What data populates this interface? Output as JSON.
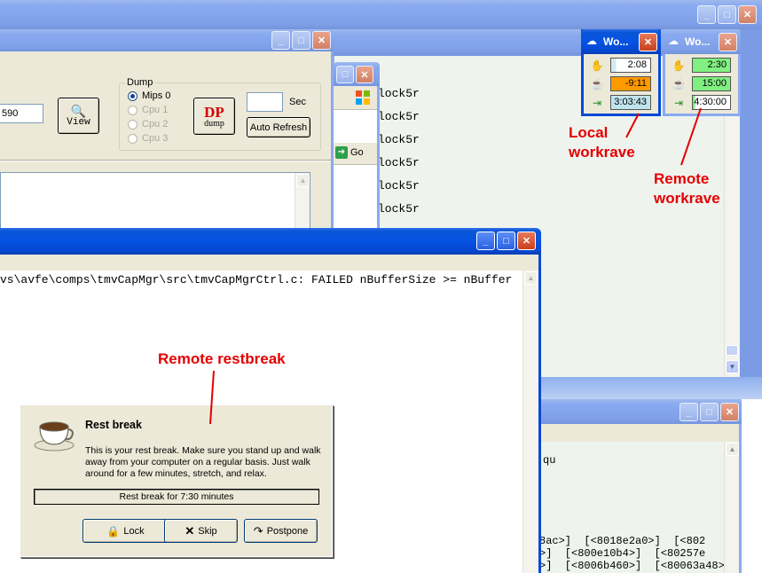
{
  "desktop": {
    "back_window": {
      "dump_group_label": "Dump",
      "radios": [
        "Mips 0",
        "Cpu 1",
        "Cpu 2",
        "Cpu 3"
      ],
      "selected_radio": "Mips 0",
      "field_value": "590",
      "view_label": "View",
      "dp_label": "DP",
      "dump_label": "dump",
      "sec_label": "Sec",
      "sec_value": "",
      "auto_refresh_label": "Auto Refresh"
    },
    "middle_window": {
      "go_label": "Go",
      "log_lines": [
        "lock5r",
        "lock5r",
        "lock5r",
        "lock5r",
        "lock5r",
        "lock5r"
      ]
    },
    "console_window": {
      "log_text": "vs\\avfe\\comps\\tmvCapMgr\\src\\tmvCapMgrCtrl.c: FAILED nBufferSize >= nBuffer"
    },
    "trace_window": {
      "top_text": "qu",
      "trace_lines": [
        "8ac>]  [<8018e2a0>]  [<802",
        ">]  [<800e10b4>]  [<80257e",
        ">]  [<8006b460>]  [<80063a48>"
      ]
    }
  },
  "workrave_local": {
    "title": "Wo...",
    "micro_value": "2:08",
    "rest_value": "-9:11",
    "daily_value": "3:03:43",
    "colors": {
      "micro_bar": "#d6eaf0",
      "rest_bar": "#ff9a00",
      "daily_bar": "#bfe4ee"
    }
  },
  "workrave_remote": {
    "title": "Wo...",
    "micro_value": "2:30",
    "rest_value": "15:00",
    "daily_value": "4:30:00",
    "colors": {
      "bar": "#80f080"
    }
  },
  "annotations": {
    "local_line1": "Local",
    "local_line2": "workrave",
    "remote_line1": "Remote",
    "remote_line2": "workrave",
    "remote_restbreak": "Remote restbreak",
    "color": "#e50000"
  },
  "rest_break_dialog": {
    "title": "Rest break",
    "body": "This is your rest break. Make sure you stand up and walk away from your computer on a regular basis. Just walk around for a few minutes, stretch, and relax.",
    "progress_text": "Rest break for 7:30 minutes",
    "lock_label": "Lock",
    "skip_label": "Skip",
    "postpone_label": "Postpone"
  }
}
